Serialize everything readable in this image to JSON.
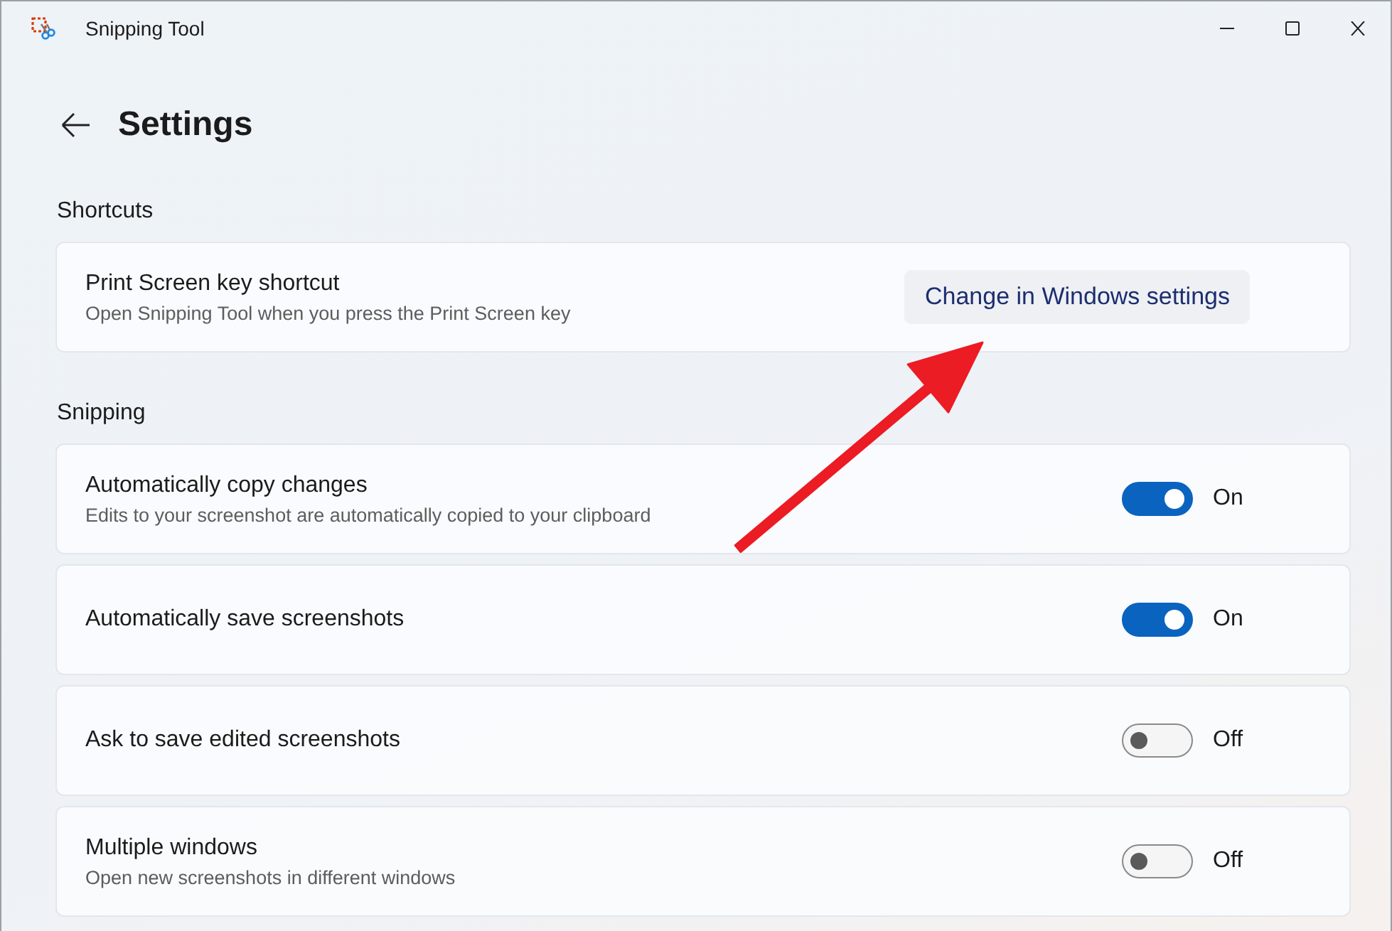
{
  "window": {
    "title": "Snipping Tool"
  },
  "page": {
    "title": "Settings"
  },
  "sections": [
    {
      "heading": "Shortcuts",
      "items": [
        {
          "kind": "button",
          "title": "Print Screen key shortcut",
          "description": "Open Snipping Tool when you press the Print Screen key",
          "button": "Change in Windows settings"
        }
      ]
    },
    {
      "heading": "Snipping",
      "items": [
        {
          "kind": "toggle",
          "title": "Automatically copy changes",
          "description": "Edits to your screenshot are automatically copied to your clipboard",
          "on": true,
          "state_label": "On"
        },
        {
          "kind": "toggle",
          "title": "Automatically save screenshots",
          "on": true,
          "state_label": "On"
        },
        {
          "kind": "toggle",
          "title": "Ask to save edited screenshots",
          "on": false,
          "state_label": "Off"
        },
        {
          "kind": "toggle",
          "title": "Multiple windows",
          "description": "Open new screenshots in different windows",
          "on": false,
          "state_label": "Off"
        }
      ]
    }
  ]
}
